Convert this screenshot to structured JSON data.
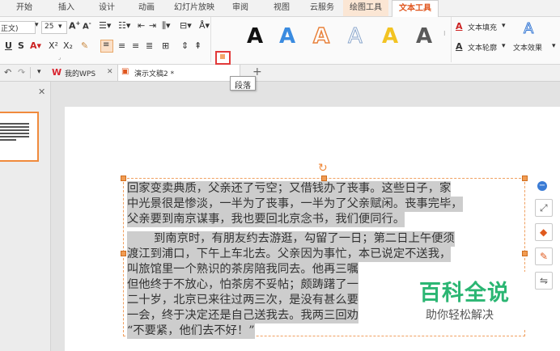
{
  "tabs": [
    "开始",
    "插入",
    "设计",
    "动画",
    "幻灯片放映",
    "审阅",
    "视图",
    "云服务",
    "绘图工具",
    "文本工具"
  ],
  "active_tab": "文本工具",
  "ribbon": {
    "font_name": "正文)",
    "font_size": "25",
    "text_fill_label": "文本填充",
    "text_outline_label": "文本轮廓",
    "text_effect_label": "文本效果",
    "style_letter": "A",
    "style_colors": [
      "#111111",
      "#3a8be0",
      "#e8823c",
      "#9ab6dc",
      "#f2c322",
      "#5a5a5a"
    ]
  },
  "tooltip": "段落",
  "doc_tabs": {
    "wps_label": "我的WPS",
    "doc_label": "演示文稿2 *"
  },
  "document": {
    "para1": [
      "回家变卖典质，父亲还了亏空；又借钱办了丧事。这些日子，家",
      "中光景很是惨淡，一半为了丧事，一半为了父亲赋闲。丧事完毕，",
      "父亲要到南京谋事，我也要回北京念书，我们便同行。"
    ],
    "para2": [
      "到南京时，有朋友约去游逛，勾留了一日；第二日上午便须",
      "渡江到浦口，下午上车北去。父亲因为事忙，本已说定不送我，",
      "叫旅馆里一个熟识的茶房陪我同去。他再三嘱",
      "但他终于不放心，怕茶房不妥帖；颇踌躇了一",
      "二十岁，北京已来往过两三次，是没有甚么要",
      "一会，终于决定还是自己送我去。我两三回劝",
      "“不要紧，他们去不好！”"
    ]
  },
  "watermark": {
    "title": "百科全说",
    "subtitle": "助你轻松解决"
  }
}
